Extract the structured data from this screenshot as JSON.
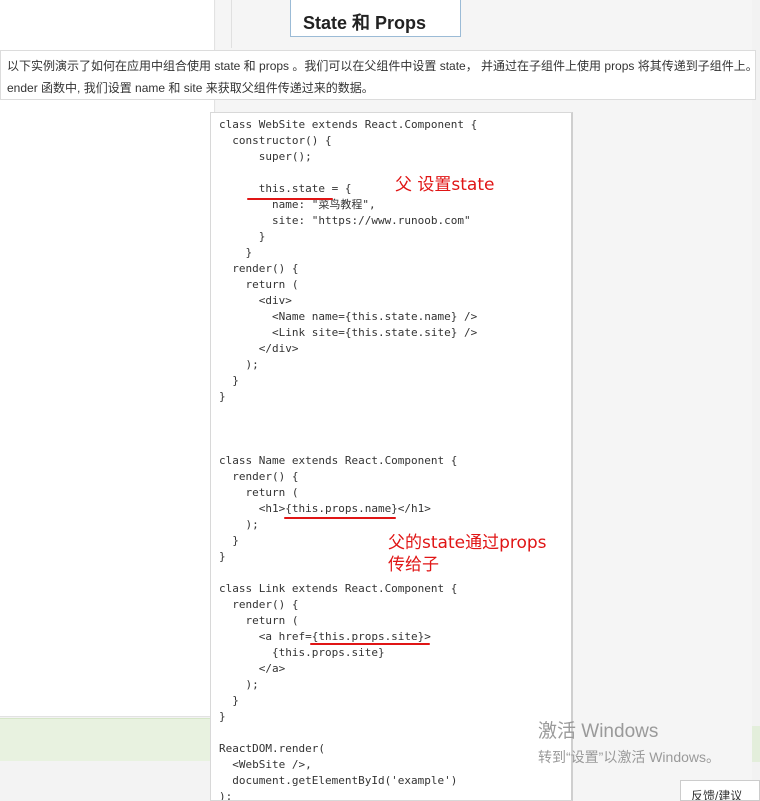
{
  "title": "State 和 Props",
  "intro": {
    "line1": "以下实例演示了如何在应用中组合使用 state 和 props 。我们可以在父组件中设置 state， 并通过在子组件上使用 props 将其传递到子组件上。在 r",
    "line2": "ender 函数中, 我们设置 name 和 site 来获取父组件传递过来的数据。"
  },
  "code_lines": [
    "class WebSite extends React.Component {",
    "  constructor() {",
    "      super();",
    "",
    "      this.state = {",
    "        name: \"菜鸟教程\",",
    "        site: \"https://www.runoob.com\"",
    "      }",
    "    }",
    "  render() {",
    "    return (",
    "      <div>",
    "        <Name name={this.state.name} />",
    "        <Link site={this.state.site} />",
    "      </div>",
    "    );",
    "  }",
    "}",
    "",
    "",
    "",
    "class Name extends React.Component {",
    "  render() {",
    "    return (",
    "      <h1>{this.props.name}</h1>",
    "    );",
    "  }",
    "}",
    "",
    "class Link extends React.Component {",
    "  render() {",
    "    return (",
    "      <a href={this.props.site}>",
    "        {this.props.site}",
    "      </a>",
    "    );",
    "  }",
    "}",
    "",
    "ReactDOM.render(",
    "  <WebSite />,",
    "  document.getElementById('example')",
    ");"
  ],
  "annotations": {
    "parent_state": "父 设置state",
    "pass_line1": "父的state通过props",
    "pass_line2": "传给子"
  },
  "watermark": {
    "line1": "激活 Windows",
    "line2": "转到“设置”以激活 Windows。"
  },
  "feedback_label": "反馈/建议",
  "colors": {
    "annotation_red": "#e01515",
    "code_keyword": "#1a2e9c",
    "title_border": "#9bbbd6"
  }
}
